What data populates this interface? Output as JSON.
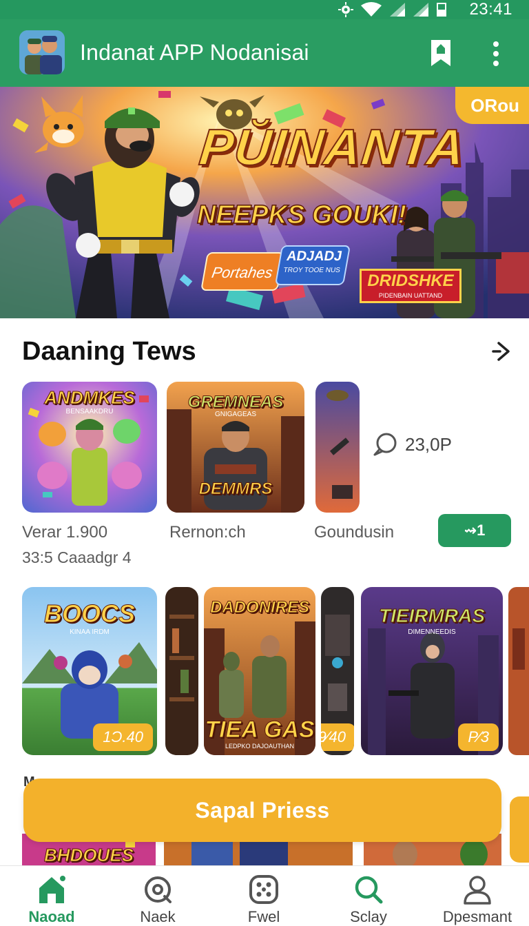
{
  "status_bar": {
    "time": "23:41"
  },
  "app_bar": {
    "title": "Indanat APP Nodanisai"
  },
  "banner": {
    "tag": "ORou",
    "title": "PŬINANTA",
    "subtitle": "NEEPKS GOUKI!",
    "button_orange": "Portahes",
    "button_blue_line1": "ADJADJ",
    "button_blue_line2": "TROY TOOE NUS",
    "badge_line1": "DRIDSHKE",
    "badge_line2": "PIDENBAIN UATTAND"
  },
  "section": {
    "title": "Daaning Tews"
  },
  "row1": {
    "tiles": [
      {
        "title": "ANDMKES",
        "subtitle": "BENSAAKDRU"
      },
      {
        "title": "GREMNEAS",
        "subtitle": "GNIGAGEAS",
        "bottom_text": "DEMMRS"
      },
      {
        "title": ""
      }
    ],
    "captions": [
      {
        "line1": "Verar 1.900",
        "line2": "33:5  Caaadgr 4"
      },
      {
        "line1": "Rernon:ch"
      },
      {
        "line1": "Goundusin"
      }
    ],
    "views": "23,0P",
    "play_label": "⇝1"
  },
  "row2": {
    "tiles": [
      {
        "title": "BOOCS",
        "subtitle": "KINAA IRDM",
        "price": "1Ɔ.40"
      },
      {
        "title": "DADONIRES",
        "bottom_text": "TIEA GAS",
        "bottom_sub": "LEDPKO DAJOAUTHAN",
        "price": "9⁄40"
      },
      {
        "title": "TIEIRMRAS",
        "subtitle": "DIMENNEEDIS",
        "price": "P⁄3"
      }
    ]
  },
  "peek_text": "M",
  "peek_row": {
    "title": "BHDOUES"
  },
  "cta": {
    "label": "Sapal Priess"
  },
  "bottom_nav": [
    {
      "label": "Naoad",
      "icon": "home-icon",
      "active": true
    },
    {
      "label": "Naek",
      "icon": "target-icon",
      "active": false
    },
    {
      "label": "Fwel",
      "icon": "grid-dots-icon",
      "active": false
    },
    {
      "label": "Sclay",
      "icon": "search-icon",
      "active": false
    },
    {
      "label": "Dpesmant",
      "icon": "profile-icon",
      "active": false
    }
  ],
  "colors": {
    "primary_green": "#2a9d62",
    "accent_yellow": "#f3b12b",
    "text_dark": "#111111",
    "text_muted": "#5b5b5b"
  }
}
